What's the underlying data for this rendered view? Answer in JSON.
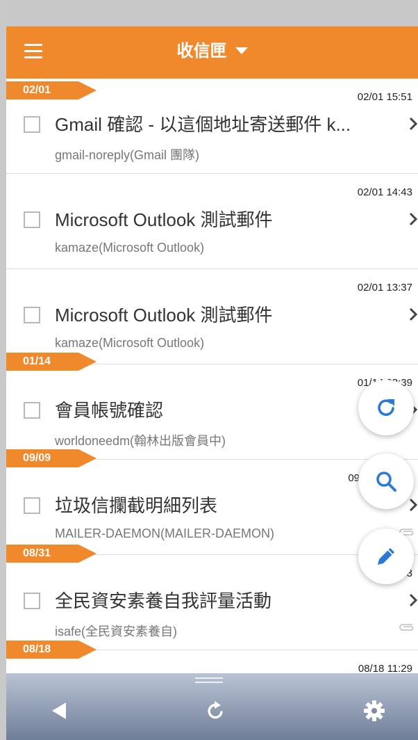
{
  "header": {
    "title": "收信匣",
    "menu_icon": "hamburger-menu-icon",
    "dropdown_icon": "caret-down-icon"
  },
  "colors": {
    "accent": "#f0892c",
    "fab_icon": "#2a7ad5",
    "toolbar_top": "#b9c3d4",
    "toolbar_bottom": "#6f7e98"
  },
  "emails": [
    {
      "time": "02/01 15:51",
      "subject": "Gmail 確認 - 以這個地址寄送郵件 k...",
      "sender": "gmail-noreply(Gmail 團隊)",
      "attachment": false
    },
    {
      "time": "02/01 14:43",
      "subject": "Microsoft Outlook 測試郵件",
      "sender": "kamaze(Microsoft Outlook)",
      "attachment": false
    },
    {
      "time": "02/01 13:37",
      "subject": "Microsoft Outlook 測試郵件",
      "sender": "kamaze(Microsoft Outlook)",
      "attachment": false
    },
    {
      "time": "01/14 08:39",
      "subject": "會員帳號確認",
      "sender": "worldoneedm(翰林出版會員中)",
      "attachment": false
    },
    {
      "time": "09",
      "subject": "垃圾信攔截明細列表",
      "sender": "MAILER-DAEMON(MAILER-DAEMON)",
      "attachment": true
    },
    {
      "time": "08/...3",
      "subject": "全民資安素養自我評量活動",
      "sender": "isafe(全民資安素養自)",
      "attachment": true
    },
    {
      "time": "08/18 11:29",
      "subject": "",
      "sender": "",
      "attachment": false
    }
  ],
  "date_tags": [
    "02/01",
    "01/14",
    "09/09",
    "08/31",
    "08/18"
  ],
  "fabs": [
    {
      "name": "refresh-fab",
      "icon": "refresh-icon"
    },
    {
      "name": "search-fab",
      "icon": "search-icon"
    },
    {
      "name": "compose-fab",
      "icon": "pencil-icon"
    }
  ],
  "toolbar": {
    "back_icon": "back-triangle-icon",
    "reload_icon": "reload-icon",
    "settings_icon": "gear-icon"
  }
}
